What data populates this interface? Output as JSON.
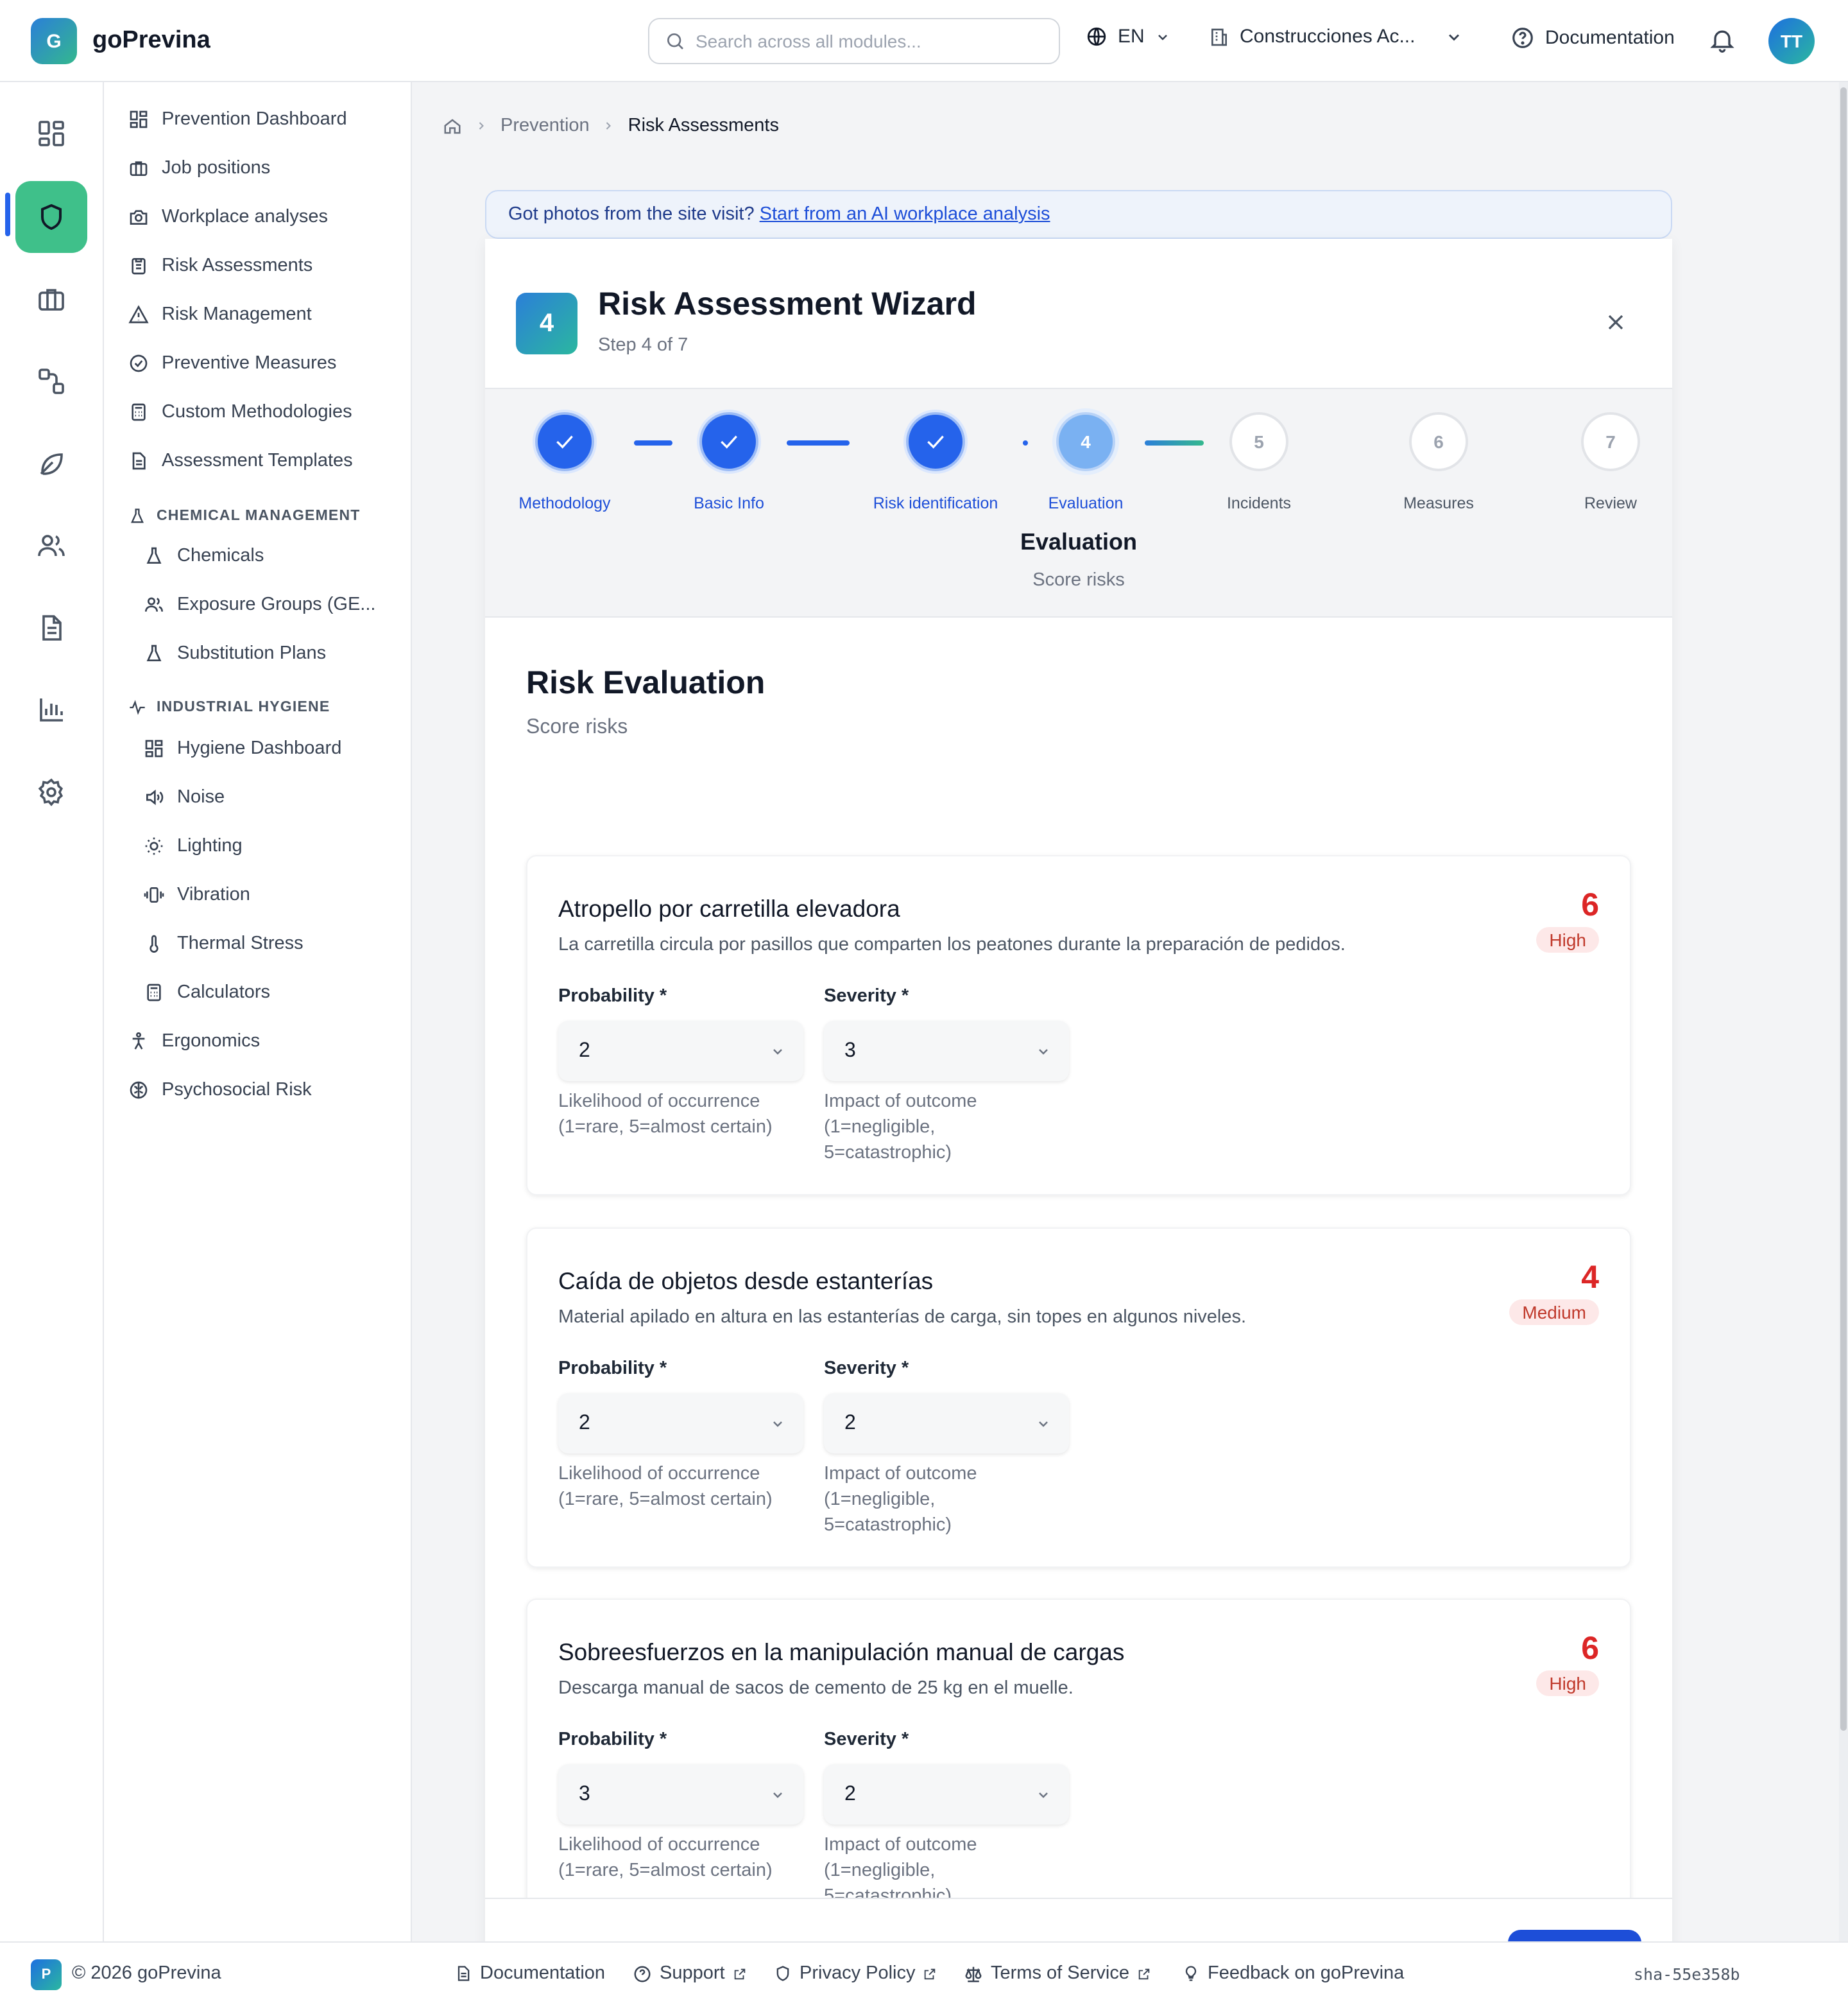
{
  "header": {
    "logo_letter": "G",
    "app_name": "goPrevina",
    "search_placeholder": "Search across all modules...",
    "language": "EN",
    "company": "Construcciones Ac...",
    "documentation": "Documentation",
    "avatar_initials": "TT"
  },
  "rail": {
    "icons": [
      "dashboard-icon",
      "shield-icon",
      "briefcase-icon",
      "workflow-icon",
      "leaf-icon",
      "users-icon",
      "document-icon",
      "bar-chart-icon",
      "settings-icon"
    ],
    "active": "shield-icon"
  },
  "sidebar": {
    "items": [
      {
        "label": "Prevention Dashboard",
        "icon": "grid-icon"
      },
      {
        "label": "Job positions",
        "icon": "briefcase-icon"
      },
      {
        "label": "Workplace analyses",
        "icon": "camera-icon"
      },
      {
        "label": "Risk Assessments",
        "icon": "clipboard-icon"
      },
      {
        "label": "Risk Management",
        "icon": "warning-icon"
      },
      {
        "label": "Preventive Measures",
        "icon": "check-circle-icon"
      },
      {
        "label": "Custom Methodologies",
        "icon": "calculator-icon"
      },
      {
        "label": "Assessment Templates",
        "icon": "document-icon"
      }
    ],
    "chemical_section": "CHEMICAL MANAGEMENT",
    "chemical_items": [
      {
        "label": "Chemicals",
        "icon": "flask-icon"
      },
      {
        "label": "Exposure Groups (GE...",
        "icon": "users-icon"
      },
      {
        "label": "Substitution Plans",
        "icon": "flask-icon"
      }
    ],
    "hygiene_section": "INDUSTRIAL HYGIENE",
    "hygiene_items": [
      {
        "label": "Hygiene Dashboard",
        "icon": "grid-icon"
      },
      {
        "label": "Noise",
        "icon": "speaker-icon"
      },
      {
        "label": "Lighting",
        "icon": "sun-icon"
      },
      {
        "label": "Vibration",
        "icon": "vibration-icon"
      },
      {
        "label": "Thermal Stress",
        "icon": "thermometer-icon"
      },
      {
        "label": "Calculators",
        "icon": "calculator-icon"
      }
    ],
    "bottom_items": [
      {
        "label": "Ergonomics",
        "icon": "person-icon"
      },
      {
        "label": "Psychosocial Risk",
        "icon": "brain-icon"
      }
    ]
  },
  "breadcrumb": {
    "items": [
      "Prevention",
      "Risk Assessments"
    ]
  },
  "banner": {
    "text": "Got photos from the site visit?",
    "link": "Start from an AI workplace analysis"
  },
  "wizard": {
    "badge": "4",
    "title": "Risk Assessment Wizard",
    "step_text": "Step 4 of 7",
    "steps": [
      {
        "number": "1",
        "label": "Methodology",
        "state": "done"
      },
      {
        "number": "2",
        "label": "Basic Info",
        "state": "done"
      },
      {
        "number": "3",
        "label": "Risk identification",
        "state": "done"
      },
      {
        "number": "4",
        "label": "Evaluation",
        "state": "current"
      },
      {
        "number": "5",
        "label": "Incidents",
        "state": "pending"
      },
      {
        "number": "6",
        "label": "Measures",
        "state": "pending"
      },
      {
        "number": "7",
        "label": "Review",
        "state": "pending"
      }
    ],
    "current_step_title": "Evaluation",
    "current_step_subtitle": "Score risks"
  },
  "evaluation": {
    "title": "Risk Evaluation",
    "subtitle": "Score risks",
    "probability_label": "Probability *",
    "severity_label": "Severity *",
    "probability_help_1": "Likelihood of occurrence",
    "probability_help_2": "(1=rare, 5=almost certain)",
    "severity_help_1": "Impact of outcome",
    "severity_help_2": "(1=negligible,",
    "severity_help_3": "5=catastrophic)",
    "risks": [
      {
        "title": "Atropello por carretilla elevadora",
        "description": "La carretilla circula por pasillos que comparten los peatones durante la preparación de pedidos.",
        "score": "6",
        "level": "High",
        "probability": "2",
        "severity": "3"
      },
      {
        "title": "Caída de objetos desde estanterías",
        "description": "Material apilado en altura en las estanterías de carga, sin topes en algunos niveles.",
        "score": "4",
        "level": "Medium",
        "probability": "2",
        "severity": "2"
      },
      {
        "title": "Sobreesfuerzos en la manipulación manual de cargas",
        "description": "Descarga manual de sacos de cemento de 25 kg en el muelle.",
        "score": "6",
        "level": "High",
        "probability": "3",
        "severity": "2"
      }
    ]
  },
  "footer": {
    "badge": "P",
    "copyright": "© 2026 goPrevina",
    "links": [
      "Documentation",
      "Support",
      "Privacy Policy",
      "Terms of Service",
      "Feedback on goPrevina"
    ],
    "sha": "sha-55e358b"
  },
  "colors": {
    "primary": "#2563eb",
    "accent_green": "#3fc08a",
    "risk_red": "#dc2626",
    "risk_badge_bg": "#fde8e8"
  }
}
